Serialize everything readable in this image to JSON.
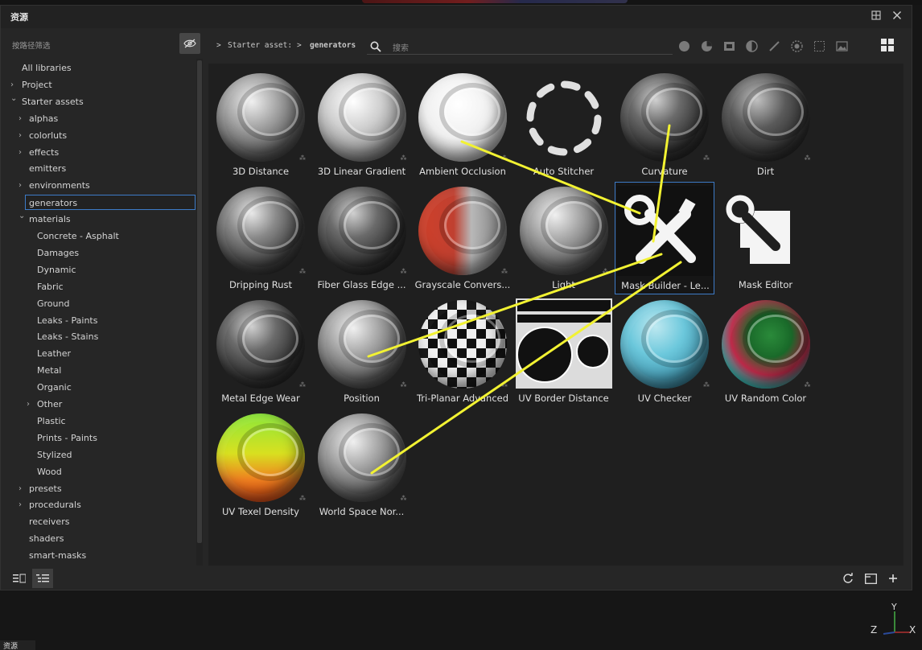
{
  "window": {
    "title": "资源"
  },
  "sidebar": {
    "filter_placeholder": "按路径筛选",
    "tree": [
      {
        "label": "All libraries",
        "level": 0,
        "arrow": ""
      },
      {
        "label": "Project",
        "level": 0,
        "arrow": ">"
      },
      {
        "label": "Starter assets",
        "level": 0,
        "arrow": "v"
      },
      {
        "label": "alphas",
        "level": 1,
        "arrow": ">"
      },
      {
        "label": "colorluts",
        "level": 1,
        "arrow": ">"
      },
      {
        "label": "effects",
        "level": 1,
        "arrow": ">"
      },
      {
        "label": "emitters",
        "level": 1,
        "arrow": ""
      },
      {
        "label": "environments",
        "level": 1,
        "arrow": ">"
      },
      {
        "label": "generators",
        "level": 1,
        "arrow": "",
        "selected": true
      },
      {
        "label": "materials",
        "level": 1,
        "arrow": "v"
      },
      {
        "label": "Concrete - Asphalt",
        "level": 2,
        "arrow": ""
      },
      {
        "label": "Damages",
        "level": 2,
        "arrow": ""
      },
      {
        "label": "Dynamic",
        "level": 2,
        "arrow": ""
      },
      {
        "label": "Fabric",
        "level": 2,
        "arrow": ""
      },
      {
        "label": "Ground",
        "level": 2,
        "arrow": ""
      },
      {
        "label": "Leaks - Paints",
        "level": 2,
        "arrow": ""
      },
      {
        "label": "Leaks - Stains",
        "level": 2,
        "arrow": ""
      },
      {
        "label": "Leather",
        "level": 2,
        "arrow": ""
      },
      {
        "label": "Metal",
        "level": 2,
        "arrow": ""
      },
      {
        "label": "Organic",
        "level": 2,
        "arrow": ""
      },
      {
        "label": "Other",
        "level": 2,
        "arrow": ">"
      },
      {
        "label": "Plastic",
        "level": 2,
        "arrow": ""
      },
      {
        "label": "Prints - Paints",
        "level": 2,
        "arrow": ""
      },
      {
        "label": "Stylized",
        "level": 2,
        "arrow": ""
      },
      {
        "label": "Wood",
        "level": 2,
        "arrow": ""
      },
      {
        "label": "presets",
        "level": 1,
        "arrow": ">"
      },
      {
        "label": "procedurals",
        "level": 1,
        "arrow": ">"
      },
      {
        "label": "receivers",
        "level": 1,
        "arrow": ""
      },
      {
        "label": "shaders",
        "level": 1,
        "arrow": ""
      },
      {
        "label": "smart-masks",
        "level": 1,
        "arrow": ""
      }
    ]
  },
  "toolbar": {
    "breadcrumb": [
      "Starter asset:",
      "generators"
    ],
    "search_placeholder": "搜索",
    "filter_icons": [
      "material-filter-icon",
      "smart-material-filter-icon",
      "texture-filter-icon",
      "mask-filter-icon",
      "brush-filter-icon",
      "procedural-filter-icon",
      "alpha-filter-icon",
      "environment-filter-icon"
    ]
  },
  "assets": [
    {
      "label": "3D Distance",
      "style": "sphere-grey"
    },
    {
      "label": "3D Linear Gradient",
      "style": "sphere-light"
    },
    {
      "label": "Ambient Occlusion",
      "style": "sphere-white"
    },
    {
      "label": "Auto Stitcher",
      "style": "dashed-ring"
    },
    {
      "label": "Curvature",
      "style": "sphere-dark"
    },
    {
      "label": "Dirt",
      "style": "sphere-dirt"
    },
    {
      "label": "Dripping Rust",
      "style": "sphere-rust"
    },
    {
      "label": "Fiber Glass Edge ...",
      "style": "sphere-dark"
    },
    {
      "label": "Grayscale Convers...",
      "style": "sphere-red"
    },
    {
      "label": "Light",
      "style": "sphere-grey"
    },
    {
      "label": "Mask Builder - Le...",
      "style": "tools-icon",
      "selected": true
    },
    {
      "label": "Mask Editor",
      "style": "wrench-icon"
    },
    {
      "label": "Metal Edge Wear",
      "style": "sphere-dark"
    },
    {
      "label": "Position",
      "style": "sphere-grey"
    },
    {
      "label": "Tri-Planar Advanced",
      "style": "sphere-checker"
    },
    {
      "label": "UV Border Distance",
      "style": "uv-border"
    },
    {
      "label": "UV Checker",
      "style": "sphere-uvcheck"
    },
    {
      "label": "UV Random Color",
      "style": "sphere-uvrandom"
    },
    {
      "label": "UV Texel Density",
      "style": "sphere-texel"
    },
    {
      "label": "World Space Nor...",
      "style": "sphere-grey"
    }
  ],
  "viewport": {
    "axis_labels": [
      "Y",
      "Z",
      "X"
    ],
    "bottom_label": "资源"
  },
  "colors": {
    "selection": "#3d7bc7",
    "annotation": "#f2f232"
  }
}
